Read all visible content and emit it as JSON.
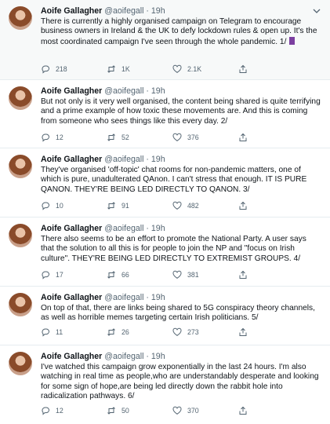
{
  "tweets": [
    {
      "name": "Aoife Gallagher",
      "handle": "@aoifegall",
      "sep": "·",
      "time": "19h",
      "text": "There is currently a highly organised campaign on Telegram to encourage business owners in Ireland & the UK to defy lockdown rules & open up. It's the most coordinated campaign I've seen through the whole pandemic. 1/",
      "replies": "218",
      "retweets": "1K",
      "likes": "2.1K"
    },
    {
      "name": "Aoife Gallagher",
      "handle": "@aoifegall",
      "sep": "·",
      "time": "19h",
      "text": "But not only is it very well organised, the content being shared is quite terrifying and a prime example of how toxic these movements are. And this is coming from someone who sees things like this every day. 2/",
      "replies": "12",
      "retweets": "52",
      "likes": "376"
    },
    {
      "name": "Aoife Gallagher",
      "handle": "@aoifegall",
      "sep": "·",
      "time": "19h",
      "text": "They've organised 'off-topic' chat rooms for non-pandemic matters, one of which is pure, unadulterated QAnon. I can't stress that enough. IT IS PURE QANON. THEY'RE BEING LED DIRECTLY TO QANON. 3/",
      "replies": "10",
      "retweets": "91",
      "likes": "482"
    },
    {
      "name": "Aoife Gallagher",
      "handle": "@aoifegall",
      "sep": "·",
      "time": "19h",
      "text": "There also seems to be an effort to promote the National Party. A user says that the solution to all this is for people to join the NP and \"focus on Irish culture\". THEY'RE BEING LED DIRECTLY TO EXTREMIST GROUPS. 4/",
      "replies": "17",
      "retweets": "66",
      "likes": "381"
    },
    {
      "name": "Aoife Gallagher",
      "handle": "@aoifegall",
      "sep": "·",
      "time": "19h",
      "text": "On top of that, there are links being shared to 5G conspiracy theory channels, as well as horrible memes targeting certain Irish politicians. 5/",
      "replies": "11",
      "retweets": "26",
      "likes": "273"
    },
    {
      "name": "Aoife Gallagher",
      "handle": "@aoifegall",
      "sep": "·",
      "time": "19h",
      "text": "I've watched this campaign grow exponentially in the last 24 hours. I'm also watching in real time as people,who are understandably desperate and looking for some sign of hope,are being led directly down the rabbit hole into radicalization pathways. 6/",
      "replies": "12",
      "retweets": "50",
      "likes": "370"
    }
  ],
  "icons": {
    "flag": "flag-icon",
    "reply": "reply-icon",
    "retweet": "retweet-icon",
    "like": "heart-icon",
    "share": "share-icon",
    "more": "chevron-down-icon"
  },
  "colors": {
    "text": "#0f1419",
    "muted": "#536471",
    "divider": "#e6ecf0",
    "flag": "#7b3fa0"
  }
}
